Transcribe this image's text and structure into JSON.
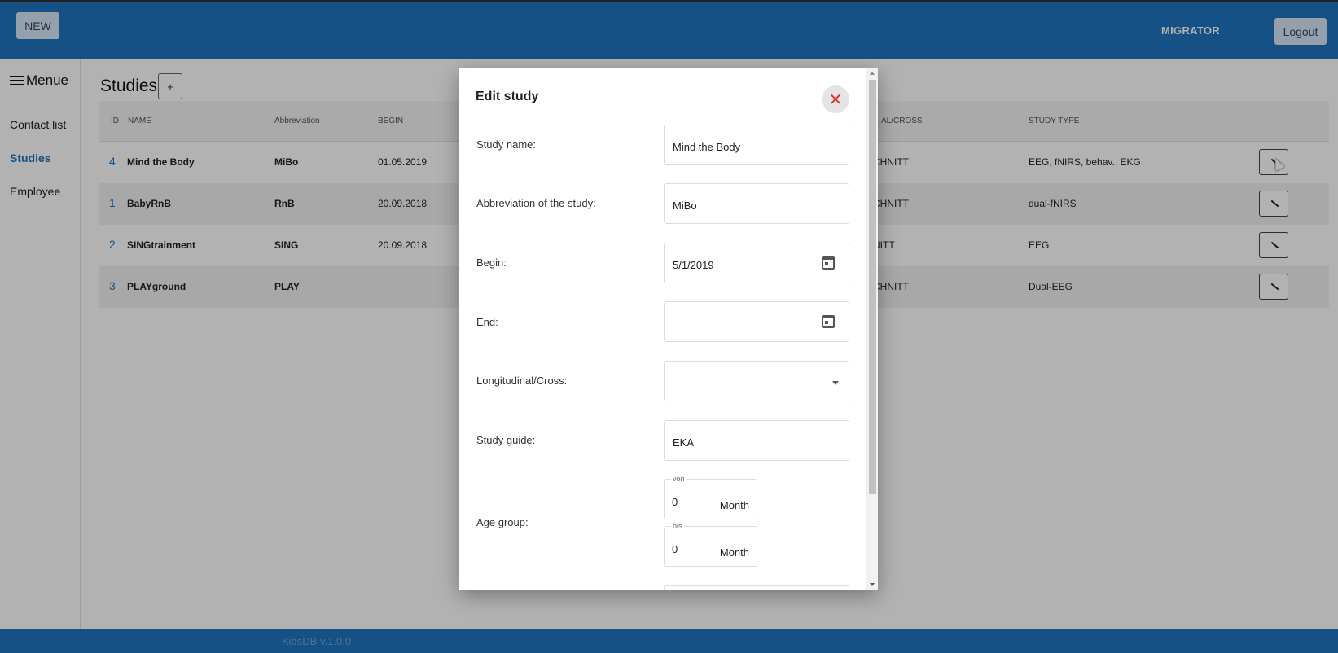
{
  "topbar": {
    "new_label": "NEW",
    "user": "MIGRATOR",
    "logout_label": "Logout"
  },
  "sidebar": {
    "title": "Menue",
    "items": [
      {
        "label": "Contact list",
        "active": false
      },
      {
        "label": "Studies",
        "active": true
      },
      {
        "label": "Employee",
        "active": false
      }
    ]
  },
  "main": {
    "title": "Studies",
    "add_label": "+"
  },
  "table": {
    "columns": [
      "ID",
      "NAME",
      "Abbreviation",
      "BEGIN",
      "…AL/CROSS",
      "STUDY TYPE"
    ],
    "rows": [
      {
        "id": "4",
        "name": "Mind the Body",
        "abbr": "MiBo",
        "begin": "01.05.2019",
        "cross": "CHNITT",
        "type": "EEG, fNIRS, behav., EKG"
      },
      {
        "id": "1",
        "name": "BabyRnB",
        "abbr": "RnB",
        "begin": "20.09.2018",
        "cross": "CHNITT",
        "type": "dual-fNIRS"
      },
      {
        "id": "2",
        "name": "SINGtrainment",
        "abbr": "SING",
        "begin": "20.09.2018",
        "cross": "NITT",
        "type": "EEG"
      },
      {
        "id": "3",
        "name": "PLAYground",
        "abbr": "PLAY",
        "begin": "",
        "cross": "CHNITT",
        "type": "Dual-EEG"
      }
    ]
  },
  "modal": {
    "title": "Edit study",
    "close_label": "✕",
    "fields": {
      "study_name": {
        "label": "Study name:",
        "value": "Mind the Body"
      },
      "abbreviation": {
        "label": "Abbreviation of the study:",
        "value": "MiBo"
      },
      "begin": {
        "label": "Begin:",
        "value": "5/1/2019"
      },
      "end": {
        "label": "End:",
        "value": ""
      },
      "longitudinal": {
        "label": "Longitudinal/Cross:",
        "value": ""
      },
      "study_guide": {
        "label": "Study guide:",
        "value": "EKA"
      },
      "age_group": {
        "label": "Age group:",
        "from_legend": "von",
        "from_value": "0",
        "from_unit": "Month",
        "to_legend": "bis",
        "to_value": "0",
        "to_unit": "Month"
      }
    }
  },
  "footer": {
    "version": "KidsDB v.1.0.0"
  },
  "icons": {
    "menu": "hamburger-icon",
    "calendar": "calendar-icon",
    "dropdown": "chevron-down-icon",
    "edit": "pencil-icon",
    "close": "close-icon"
  },
  "colors": {
    "primary": "#1f74bd",
    "close": "#dd3333",
    "button_bg": "#d6e6f4"
  }
}
